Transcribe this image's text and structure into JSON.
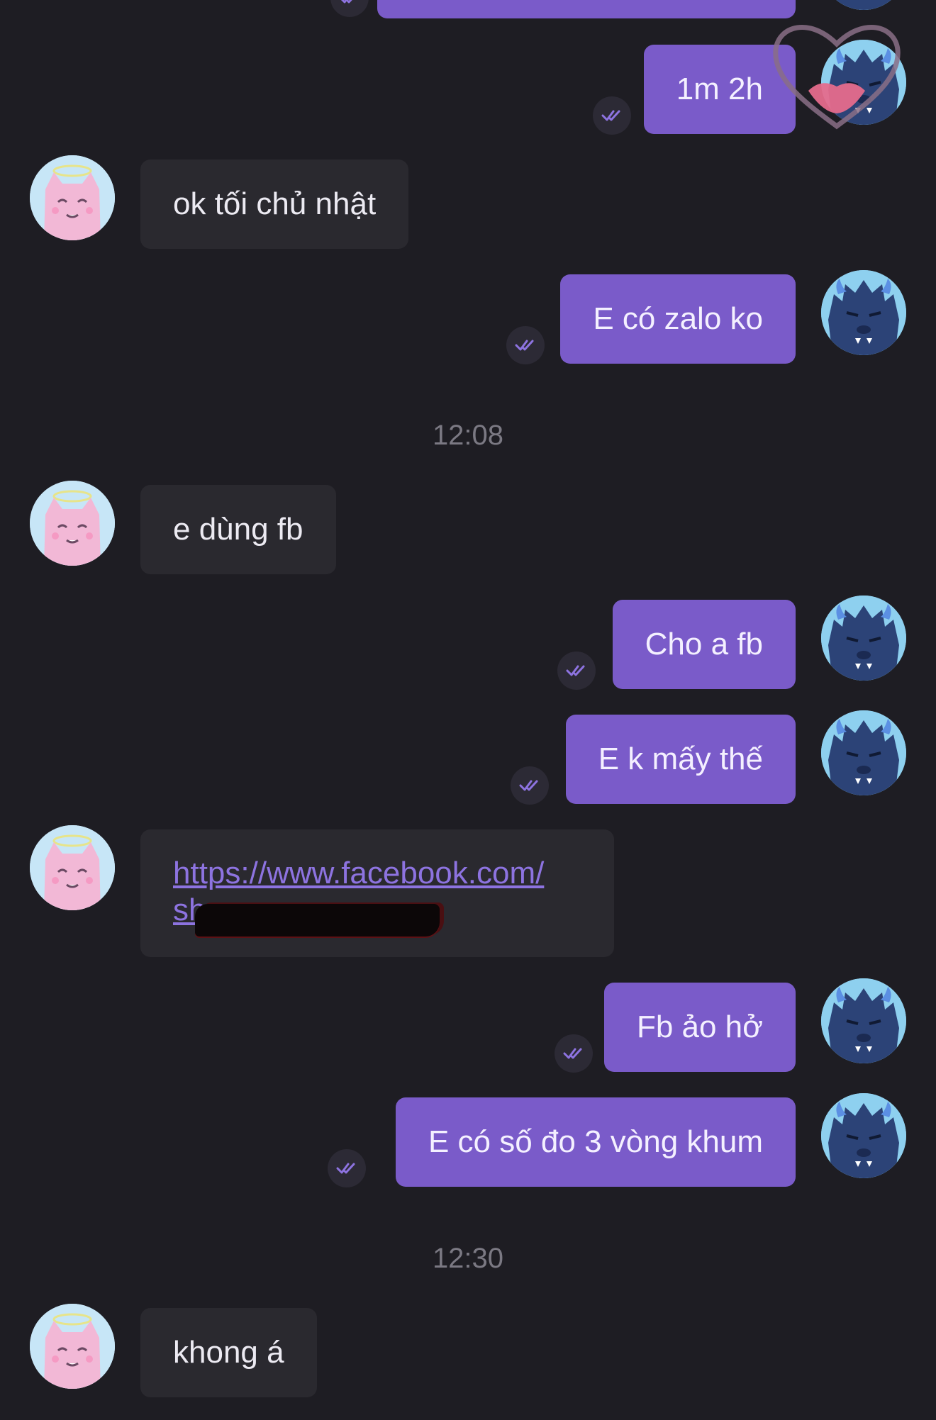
{
  "messages": [
    {
      "side": "out",
      "text": "1m 2h"
    },
    {
      "side": "in",
      "text": "ok tối chủ nhật"
    },
    {
      "side": "out",
      "text": "E có zalo ko"
    },
    {
      "type": "time",
      "text": "12:08"
    },
    {
      "side": "in",
      "text": "e dùng fb"
    },
    {
      "side": "out",
      "text": "Cho a fb"
    },
    {
      "side": "out",
      "text": "E k mấy thế"
    },
    {
      "side": "in",
      "type": "link",
      "line1": "https://www.facebook.com/",
      "line2": "sh"
    },
    {
      "side": "out",
      "text": "Fb ảo hở"
    },
    {
      "side": "out",
      "text": "E có số đo 3 vòng khum"
    },
    {
      "type": "time",
      "text": "12:30"
    },
    {
      "side": "in",
      "text": "khong á"
    }
  ],
  "icons": {
    "peer_avatar": "pink-angel-cat-avatar",
    "my_avatar": "blue-horned-monster-avatar",
    "read_status": "double-check-icon",
    "reaction": "heart-kiss-reaction-icon"
  },
  "colors": {
    "background": "#1e1d23",
    "incoming_bubble": "#2a292f",
    "outgoing_bubble": "#7a5bc9",
    "link": "#8d73e0",
    "timestamp": "#7b7983"
  }
}
